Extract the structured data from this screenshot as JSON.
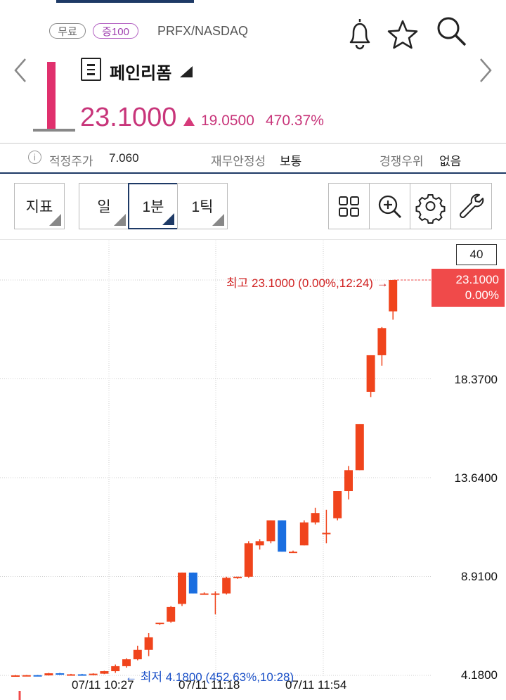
{
  "header": {
    "badges": {
      "free": "무료",
      "margin": "증100"
    },
    "ticker": "PRFX/NASDAQ",
    "stock_name": "페인리폼",
    "last_price": "23.1000",
    "change": "19.0500",
    "change_pct": "470.37%",
    "colors": {
      "up": "#c8357a",
      "accent": "#1e3a66"
    },
    "icons": [
      "bell-icon",
      "star-icon",
      "search-icon",
      "prev-arrow-icon",
      "next-arrow-icon",
      "menu-icon"
    ]
  },
  "info": {
    "fair_price_label": "적정주가",
    "fair_price_value": "7.060",
    "financial_label": "재무안정성",
    "financial_value": "보통",
    "competitive_label": "경쟁우위",
    "competitive_value": "없음"
  },
  "toolbar": {
    "indicator": "지표",
    "day": "일",
    "minute": "1분",
    "tick": "1틱",
    "icons": [
      "grid-icon",
      "zoom-in-icon",
      "settings-icon",
      "wrench-icon"
    ]
  },
  "chart_labels": {
    "top_box": "40",
    "price_tag_price": "23.1000",
    "price_tag_pct": "0.00%",
    "high_label": "최고 23.1000 (0.00%,12:24) →",
    "low_label": "← 최저 4.1800 (452.63%,10:28)",
    "y_ticks": [
      "18.3700",
      "13.6400",
      "8.9100",
      "4.1800"
    ],
    "x_ticks": [
      "07/11 10:27",
      "07/11 11:18",
      "07/11 11:54"
    ]
  },
  "chart_data": {
    "type": "candlestick",
    "y_ticks": [
      4.18,
      8.91,
      13.64,
      18.37
    ],
    "y_range": [
      3.5,
      23.5
    ],
    "up_color": "#f0441c",
    "down_color": "#1a6ee0",
    "candles": [
      {
        "o": 4.18,
        "h": 4.2,
        "l": 4.16,
        "c": 4.18
      },
      {
        "o": 4.18,
        "h": 4.2,
        "l": 4.16,
        "c": 4.19
      },
      {
        "o": 4.19,
        "h": 4.2,
        "l": 4.17,
        "c": 4.18
      },
      {
        "o": 4.18,
        "h": 4.3,
        "l": 4.17,
        "c": 4.28
      },
      {
        "o": 4.28,
        "h": 4.3,
        "l": 4.2,
        "c": 4.22
      },
      {
        "o": 4.22,
        "h": 4.25,
        "l": 4.2,
        "c": 4.23
      },
      {
        "o": 4.23,
        "h": 4.25,
        "l": 4.21,
        "c": 4.22
      },
      {
        "o": 4.22,
        "h": 4.28,
        "l": 4.18,
        "c": 4.26
      },
      {
        "o": 4.26,
        "h": 4.4,
        "l": 4.24,
        "c": 4.38
      },
      {
        "o": 4.38,
        "h": 4.7,
        "l": 4.3,
        "c": 4.62
      },
      {
        "o": 4.62,
        "h": 5.0,
        "l": 4.55,
        "c": 4.95
      },
      {
        "o": 4.95,
        "h": 5.6,
        "l": 4.9,
        "c": 5.4
      },
      {
        "o": 5.4,
        "h": 6.2,
        "l": 5.1,
        "c": 6.0
      },
      {
        "o": 6.65,
        "h": 6.7,
        "l": 6.6,
        "c": 6.7
      },
      {
        "o": 6.75,
        "h": 7.5,
        "l": 6.7,
        "c": 7.45
      },
      {
        "o": 7.6,
        "h": 9.1,
        "l": 7.5,
        "c": 9.1
      },
      {
        "o": 9.1,
        "h": 9.1,
        "l": 8.1,
        "c": 8.1
      },
      {
        "o": 8.1,
        "h": 8.15,
        "l": 8.05,
        "c": 8.1
      },
      {
        "o": 8.1,
        "h": 8.2,
        "l": 7.1,
        "c": 8.1
      },
      {
        "o": 8.1,
        "h": 8.9,
        "l": 8.05,
        "c": 8.85
      },
      {
        "o": 8.85,
        "h": 8.9,
        "l": 8.8,
        "c": 8.9
      },
      {
        "o": 8.9,
        "h": 10.6,
        "l": 8.85,
        "c": 10.5
      },
      {
        "o": 10.4,
        "h": 10.7,
        "l": 10.2,
        "c": 10.6
      },
      {
        "o": 10.6,
        "h": 11.6,
        "l": 10.5,
        "c": 11.6
      },
      {
        "o": 11.6,
        "h": 11.6,
        "l": 10.1,
        "c": 10.1
      },
      {
        "o": 10.1,
        "h": 10.15,
        "l": 10.05,
        "c": 10.1
      },
      {
        "o": 10.4,
        "h": 11.6,
        "l": 10.4,
        "c": 11.5
      },
      {
        "o": 11.5,
        "h": 12.2,
        "l": 11.4,
        "c": 11.95
      },
      {
        "o": 11.0,
        "h": 12.1,
        "l": 10.5,
        "c": 11.0
      },
      {
        "o": 11.7,
        "h": 13.0,
        "l": 11.6,
        "c": 13.0
      },
      {
        "o": 13.0,
        "h": 14.2,
        "l": 12.6,
        "c": 14.0
      },
      {
        "o": 14.0,
        "h": 16.2,
        "l": 14.0,
        "c": 16.2
      },
      {
        "o": 17.75,
        "h": 19.5,
        "l": 17.5,
        "c": 19.5
      },
      {
        "o": 19.5,
        "h": 20.85,
        "l": 19.0,
        "c": 20.8
      },
      {
        "o": 21.6,
        "h": 23.1,
        "l": 21.2,
        "c": 23.1
      }
    ]
  }
}
